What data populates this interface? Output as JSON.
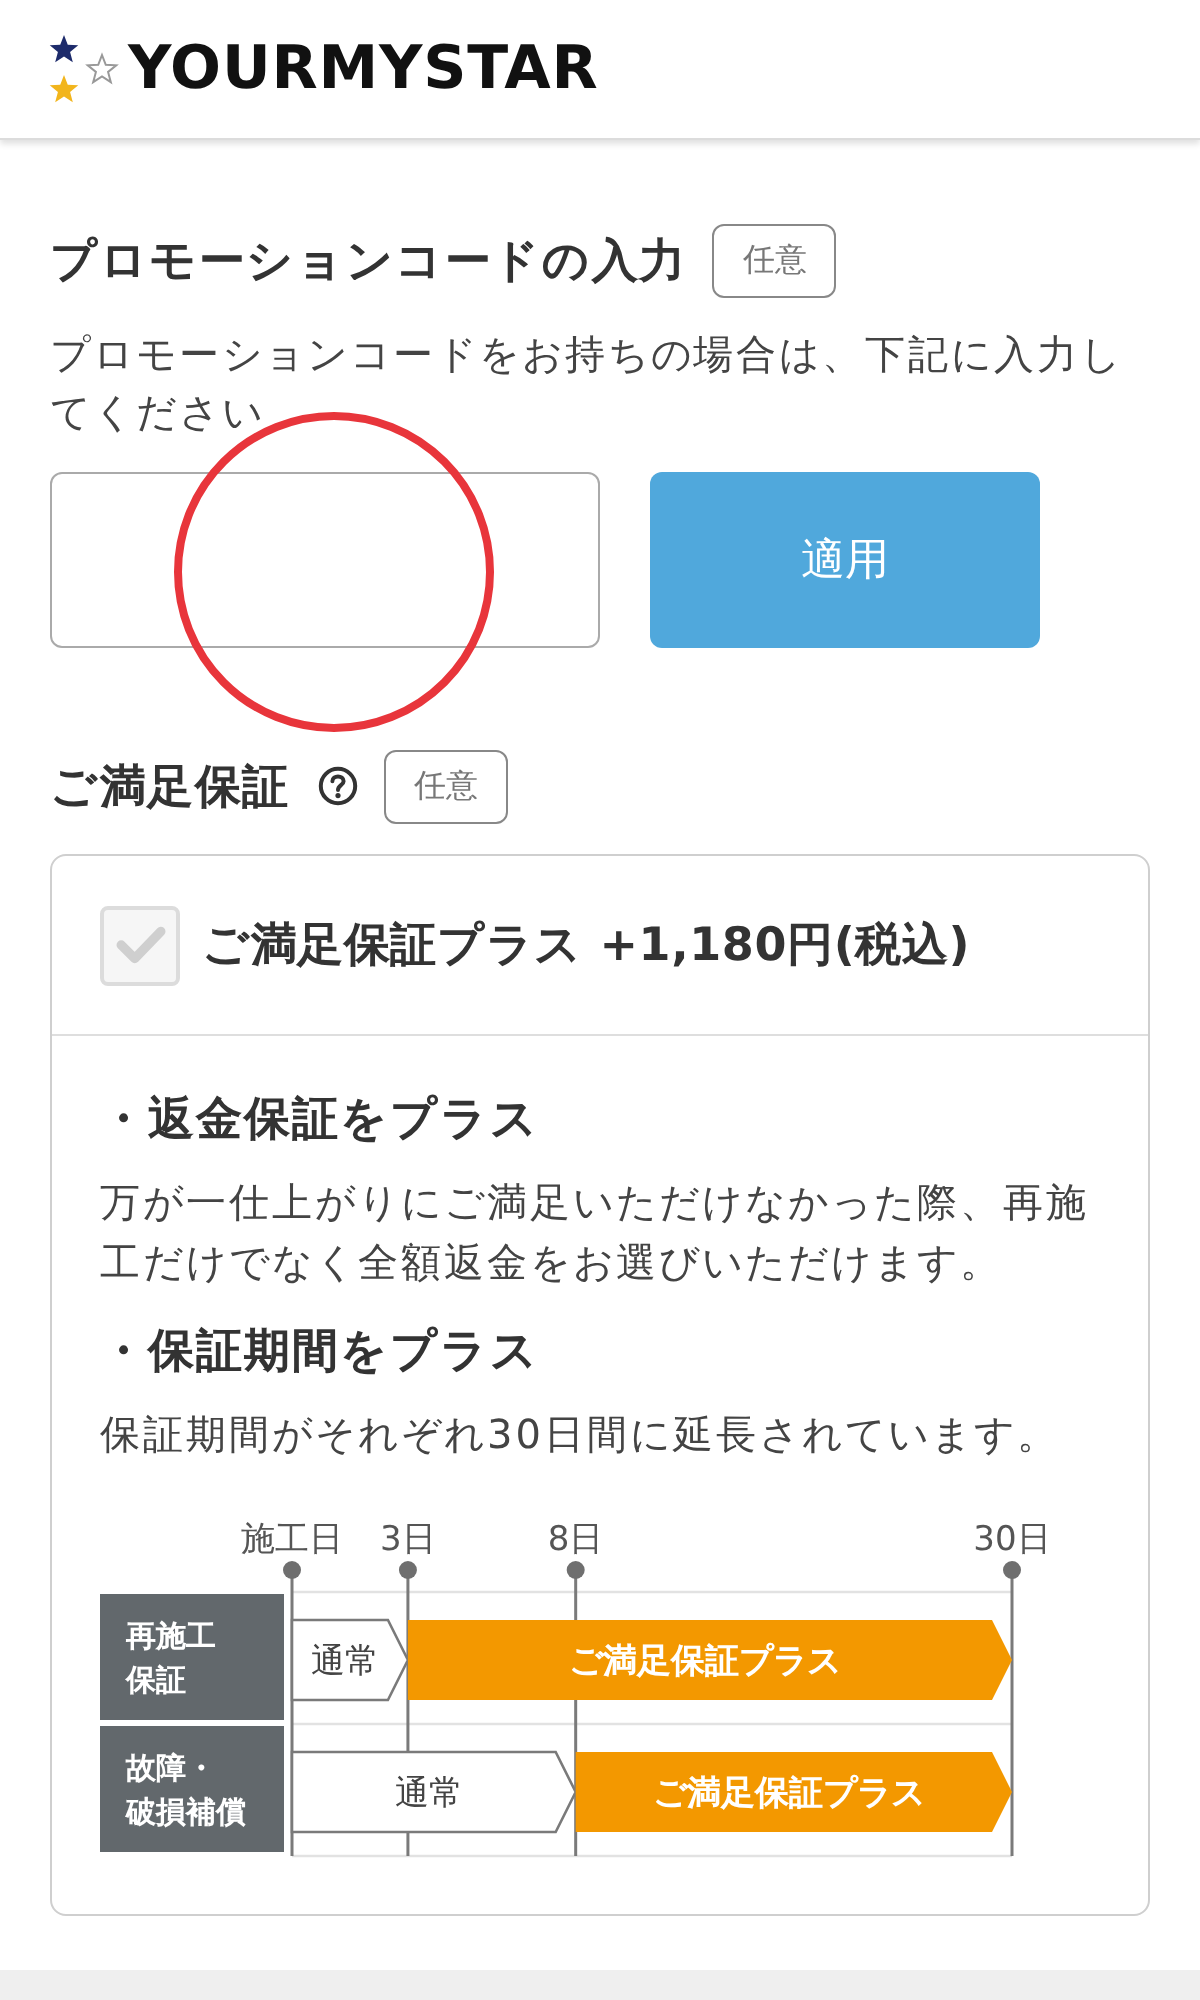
{
  "header": {
    "logo_text": "YOURMYSTAR"
  },
  "promo": {
    "title": "プロモーションコードの入力",
    "badge": "任意",
    "description": "プロモーションコードをお持ちの場合は、下記に入力してください",
    "apply_button": "適用",
    "annotation": {
      "kind": "circle"
    }
  },
  "guarantee": {
    "title": "ご満足保証",
    "badge": "任意",
    "option": {
      "label": "ご満足保証プラス +1,180円(税込)",
      "checked": false
    },
    "features": [
      {
        "heading": "・返金保証をプラス",
        "text": "万が一仕上がりにご満足いただけなかった際、再施工だけでなく全額返金をお選びいただけます。"
      },
      {
        "heading": "・保証期間をプラス",
        "text": "保証期間がそれぞれ30日間に延長されています。"
      }
    ],
    "timeline": {
      "markers": [
        "施工日",
        "3日",
        "8日",
        "30日"
      ],
      "rows": [
        {
          "label": "再施工保証",
          "periods": [
            {
              "kind": "normal",
              "label": "通常"
            },
            {
              "kind": "plus",
              "label": "ご満足保証プラス"
            },
            {
              "kind": "plus"
            }
          ]
        },
        {
          "label": "故障・破損補償",
          "periods": [
            {
              "kind": "normal",
              "label": "通常"
            },
            {
              "kind": "normal"
            },
            {
              "kind": "plus",
              "label": "ご満足保証プラス"
            }
          ]
        }
      ]
    }
  }
}
